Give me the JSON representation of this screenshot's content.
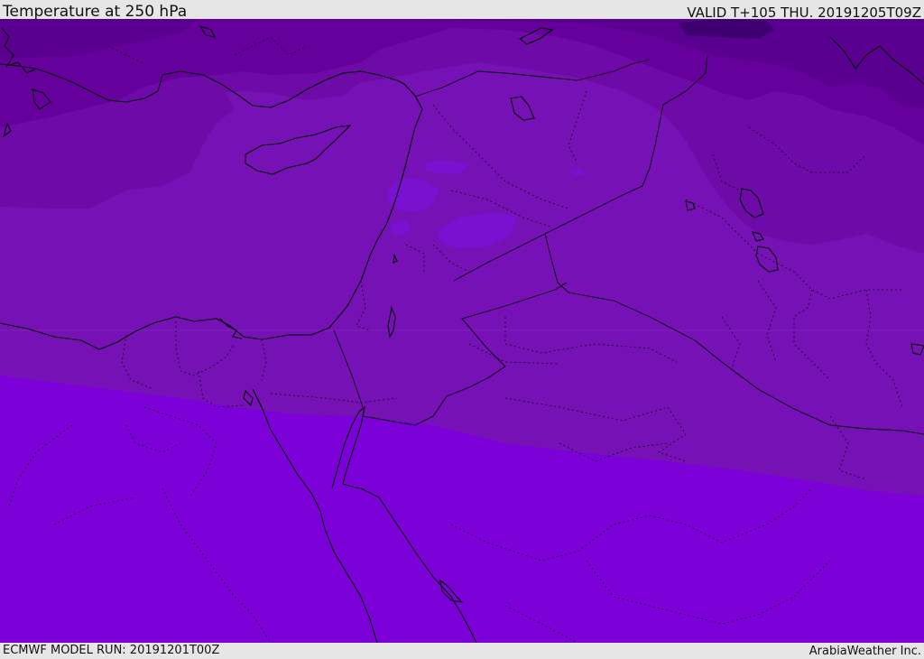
{
  "header": {
    "title": "Temperature at 250 hPa",
    "valid": "VALID T+105 THU. 20191205T09Z"
  },
  "footer": {
    "model_run": "ECMWF MODEL RUN: 20191201T00Z",
    "credit": "ArabiaWeather Inc."
  },
  "map": {
    "field": "temperature-250hpa",
    "colors": {
      "band_warmest": "#7c00d8",
      "band_warm": "#7612b5",
      "band_mid": "#6e0aa8",
      "band_cool": "#66009c",
      "band_cold": "#5a0090",
      "band_coldest": "#3e0070",
      "pocket_light": "#7a10d0",
      "border_line": "#000000"
    }
  }
}
